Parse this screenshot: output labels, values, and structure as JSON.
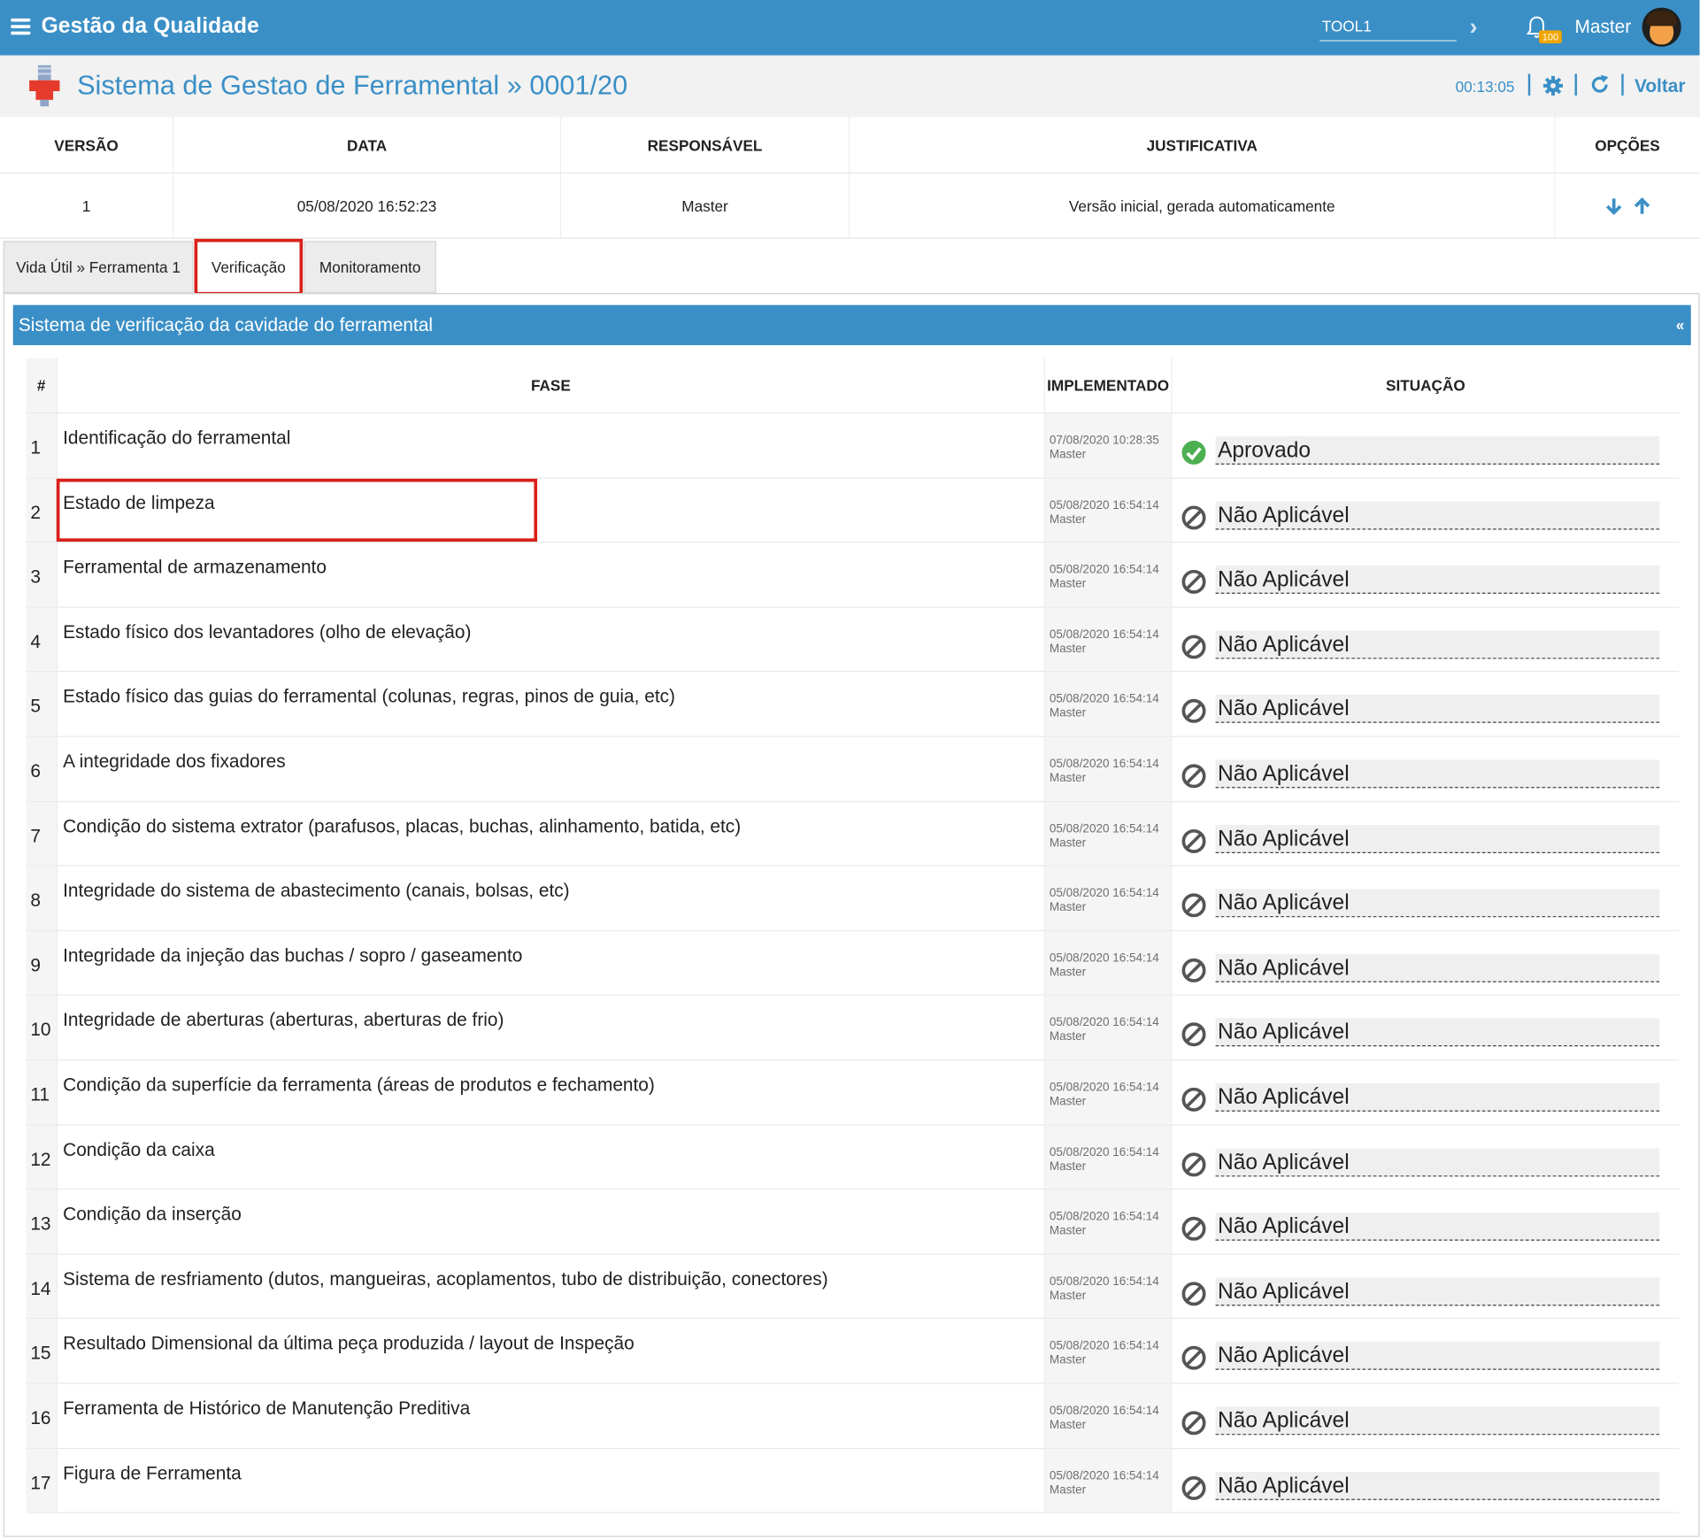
{
  "app": {
    "title": "Gestão da Qualidade",
    "tool_value": "TOOL1",
    "notification_count": "100",
    "user": "Master"
  },
  "page": {
    "title": "Sistema de Gestao de Ferramental » 0001/20",
    "timer": "00:13:05",
    "back_label": "Voltar"
  },
  "version_table": {
    "headers": {
      "version": "VERSÃO",
      "date": "DATA",
      "responsible": "RESPONSÁVEL",
      "justification": "JUSTIFICATIVA",
      "options": "OPÇÕES"
    },
    "row": {
      "version": "1",
      "date": "05/08/2020 16:52:23",
      "responsible": "Master",
      "justification": "Versão inicial, gerada automaticamente"
    }
  },
  "tabs": [
    {
      "label": "Vida Útil » Ferramenta 1"
    },
    {
      "label": "Verificação"
    },
    {
      "label": "Monitoramento"
    }
  ],
  "panel": {
    "title": "Sistema de verificação da cavidade do ferramental",
    "collapse_label": "«",
    "headers": {
      "num": "#",
      "phase": "FASE",
      "implemented": "IMPLEMENTADO",
      "status": "SITUAÇÃO"
    },
    "rows": [
      {
        "num": "1",
        "phase": "Identificação do ferramental",
        "date": "07/08/2020 10:28:35",
        "user": "Master",
        "status": "Aprovado",
        "status_icon": "check-circle-icon"
      },
      {
        "num": "2",
        "phase": "Estado de limpeza",
        "date": "05/08/2020 16:54:14",
        "user": "Master",
        "status": "Não Aplicável",
        "status_icon": "ban-icon"
      },
      {
        "num": "3",
        "phase": "Ferramental de armazenamento",
        "date": "05/08/2020 16:54:14",
        "user": "Master",
        "status": "Não Aplicável",
        "status_icon": "ban-icon"
      },
      {
        "num": "4",
        "phase": "Estado físico dos levantadores (olho de elevação)",
        "date": "05/08/2020 16:54:14",
        "user": "Master",
        "status": "Não Aplicável",
        "status_icon": "ban-icon"
      },
      {
        "num": "5",
        "phase": "Estado físico das guias do ferramental (colunas, regras, pinos de guia, etc)",
        "date": "05/08/2020 16:54:14",
        "user": "Master",
        "status": "Não Aplicável",
        "status_icon": "ban-icon"
      },
      {
        "num": "6",
        "phase": "A integridade dos fixadores",
        "date": "05/08/2020 16:54:14",
        "user": "Master",
        "status": "Não Aplicável",
        "status_icon": "ban-icon"
      },
      {
        "num": "7",
        "phase": "Condição do sistema extrator (parafusos, placas, buchas, alinhamento, batida, etc)",
        "date": "05/08/2020 16:54:14",
        "user": "Master",
        "status": "Não Aplicável",
        "status_icon": "ban-icon"
      },
      {
        "num": "8",
        "phase": "Integridade do sistema de abastecimento (canais, bolsas, etc)",
        "date": "05/08/2020 16:54:14",
        "user": "Master",
        "status": "Não Aplicável",
        "status_icon": "ban-icon"
      },
      {
        "num": "9",
        "phase": "Integridade da injeção das buchas / sopro / gaseamento",
        "date": "05/08/2020 16:54:14",
        "user": "Master",
        "status": "Não Aplicável",
        "status_icon": "ban-icon"
      },
      {
        "num": "10",
        "phase": "Integridade de aberturas (aberturas, aberturas de frio)",
        "date": "05/08/2020 16:54:14",
        "user": "Master",
        "status": "Não Aplicável",
        "status_icon": "ban-icon"
      },
      {
        "num": "11",
        "phase": "Condição da superfície da ferramenta (áreas de produtos e fechamento)",
        "date": "05/08/2020 16:54:14",
        "user": "Master",
        "status": "Não Aplicável",
        "status_icon": "ban-icon"
      },
      {
        "num": "12",
        "phase": "Condição da caixa",
        "date": "05/08/2020 16:54:14",
        "user": "Master",
        "status": "Não Aplicável",
        "status_icon": "ban-icon"
      },
      {
        "num": "13",
        "phase": "Condição da inserção",
        "date": "05/08/2020 16:54:14",
        "user": "Master",
        "status": "Não Aplicável",
        "status_icon": "ban-icon"
      },
      {
        "num": "14",
        "phase": "Sistema de resfriamento (dutos, mangueiras, acoplamentos, tubo de distribuição, conectores)",
        "date": "05/08/2020 16:54:14",
        "user": "Master",
        "status": "Não Aplicável",
        "status_icon": "ban-icon"
      },
      {
        "num": "15",
        "phase": "Resultado Dimensional da última peça produzida / layout de Inspeção",
        "date": "05/08/2020 16:54:14",
        "user": "Master",
        "status": "Não Aplicável",
        "status_icon": "ban-icon"
      },
      {
        "num": "16",
        "phase": "Ferramenta de Histórico de Manutenção Preditiva",
        "date": "05/08/2020 16:54:14",
        "user": "Master",
        "status": "Não Aplicável",
        "status_icon": "ban-icon"
      },
      {
        "num": "17",
        "phase": "Figura de Ferramenta",
        "date": "05/08/2020 16:54:14",
        "user": "Master",
        "status": "Não Aplicável",
        "status_icon": "ban-icon"
      }
    ]
  },
  "colors": {
    "primary": "#3a8fc6",
    "highlight": "#d9201a",
    "approved": "#4caf50",
    "badge": "#f0a500"
  }
}
